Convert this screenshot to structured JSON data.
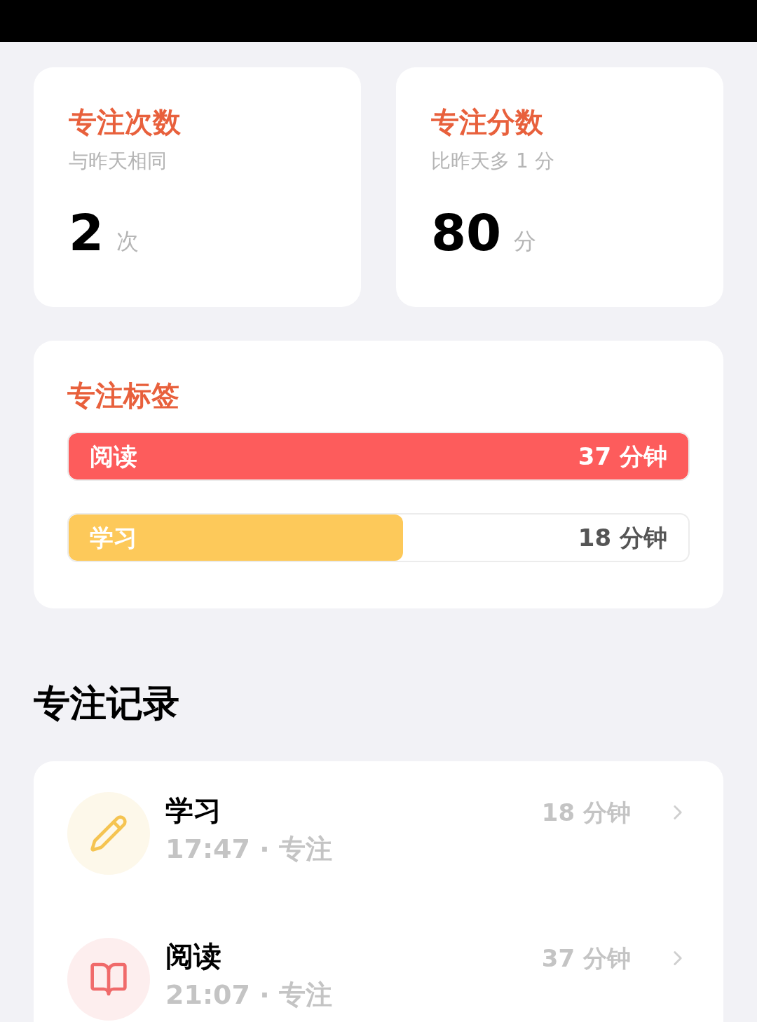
{
  "stat_cards": [
    {
      "title": "专注次数",
      "comparison": "与昨天相同",
      "value": "2",
      "unit": "次"
    },
    {
      "title": "专注分数",
      "comparison": "比昨天多 1 分",
      "value": "80",
      "unit": "分"
    }
  ],
  "tags": {
    "title": "专注标签",
    "bars": [
      {
        "label": "阅读",
        "reading": "37 分钟",
        "level": 1.0,
        "color": "#fd5c5c"
      },
      {
        "label": "学习",
        "reading": "18 分钟",
        "level": 0.54,
        "color": "#fdc95a"
      }
    ]
  },
  "records": {
    "title": "专注记录",
    "items": [
      {
        "kind": "pencil",
        "name": "学习",
        "subtitle": "17:47 · 专注",
        "duration": "18 分钟"
      },
      {
        "kind": "book",
        "name": "阅读",
        "subtitle": "21:07 · 专注",
        "duration": "37 分钟"
      }
    ]
  }
}
